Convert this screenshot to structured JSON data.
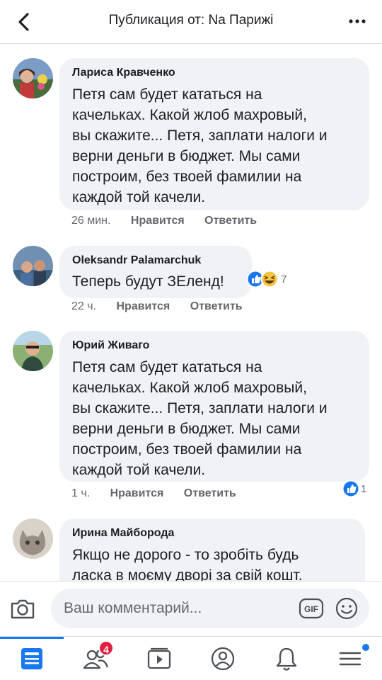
{
  "header": {
    "title": "Публикация от: Na Парижі"
  },
  "comments": [
    {
      "author": "Лариса Кравченко",
      "text": "Петя сам будет кататься на\nкачельках. Какой жлоб махровый,\nвы скажите... Петя, заплати налоги и\nверни деньги в бюджет.  Мы сами\nпостроим, без твоей фамилии на\nкаждой той качели.",
      "time": "26 мин.",
      "like": "Нравится",
      "reply": "Ответить"
    },
    {
      "author": "Oleksandr Palamarchuk",
      "text": "Теперь будут ЗЕленд!",
      "time": "22 ч.",
      "like": "Нравится",
      "reply": "Ответить",
      "reaction_count": "7"
    },
    {
      "author": "Юрий Живаго",
      "text": "Петя сам будет кататься на\nкачельках. Какой жлоб махровый,\nвы скажите... Петя, заплати налоги и\nверни деньги в бюджет.  Мы сами\nпостроим, без твоей фамилии на\nкаждой той качели.",
      "time": "1 ч.",
      "like": "Нравится",
      "reply": "Ответить",
      "reaction_count": "1"
    },
    {
      "author": "Ирина Майборода",
      "text": "Якщо не дорого - то зробіть будь\nласка в моєму дворі за свій кошт."
    }
  ],
  "composer": {
    "placeholder": "Ваш комментарий..."
  },
  "nav": {
    "friends_badge": "4"
  },
  "colors": {
    "accent": "#1877f2",
    "bubble": "#f0f2f5",
    "badge": "#e41e3f",
    "meta": "#65676b"
  }
}
